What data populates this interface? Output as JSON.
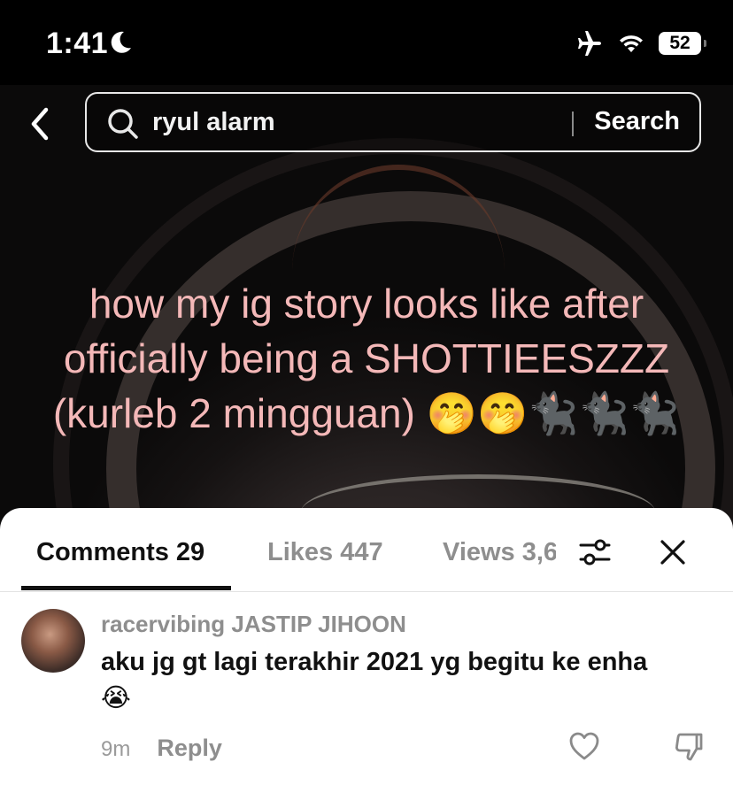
{
  "status": {
    "time": "1:41",
    "battery": "52"
  },
  "search": {
    "query": "ryul alarm",
    "button": "Search"
  },
  "caption": {
    "line1": "how my ig story looks like after",
    "line2": "officially being a SHOTTIEESZZZ",
    "line3": "(kurleb 2 mingguan)",
    "emoji": "🤭🤭🐈‍⬛🐈‍⬛🐈‍⬛"
  },
  "tabs": {
    "comments": "Comments 29",
    "likes": "Likes 447",
    "views": "Views 3,6"
  },
  "comment": {
    "username": "racervibing JASTIP JIHOON",
    "text": "aku jg gt lagi terakhir 2021 yg begitu ke enha",
    "emoji": "😭",
    "time": "9m",
    "reply": "Reply"
  },
  "icons": [
    "moon-icon",
    "airplane-icon",
    "wifi-icon",
    "battery-icon",
    "back-icon",
    "search-icon",
    "filter-icon",
    "close-icon",
    "heart-icon",
    "dislike-icon"
  ]
}
